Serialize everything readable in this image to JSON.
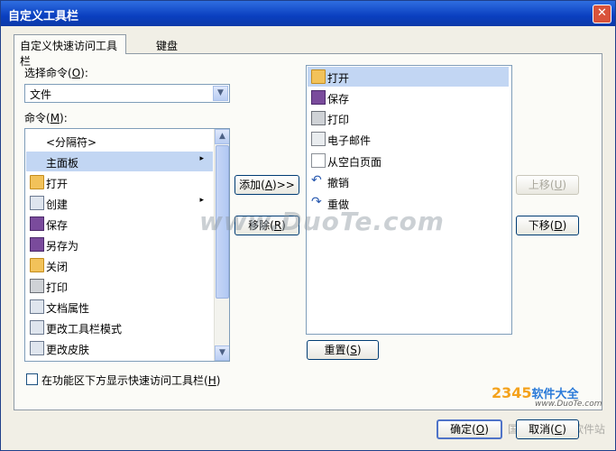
{
  "dialog": {
    "title": "自定义工具栏",
    "close": "✕"
  },
  "tabs": [
    {
      "label": "自定义快速访问工具栏"
    },
    {
      "label": "键盘"
    }
  ],
  "choose_command": {
    "label_pre": "选择命令(",
    "label_key": "O",
    "label_post": "):",
    "selected_value": "文件"
  },
  "commands": {
    "label_pre": "命令(",
    "label_key": "M",
    "label_post": "):",
    "items": [
      {
        "label": "<分隔符>",
        "icon": "none"
      },
      {
        "label": "主面板",
        "icon": "none",
        "submenu": "▸"
      },
      {
        "label": "打开",
        "icon": "folder-open-icon"
      },
      {
        "label": "创建",
        "icon": "new-document-icon",
        "submenu": "▸"
      },
      {
        "label": "保存",
        "icon": "save-icon"
      },
      {
        "label": "另存为",
        "icon": "save-as-icon"
      },
      {
        "label": "关闭",
        "icon": "close-folder-icon"
      },
      {
        "label": "打印",
        "icon": "printer-icon"
      },
      {
        "label": "文档属性",
        "icon": "properties-icon"
      },
      {
        "label": "更改工具栏模式",
        "icon": "toolbar-mode-icon"
      },
      {
        "label": "更改皮肤",
        "icon": "skin-icon"
      }
    ]
  },
  "toolbar_items": {
    "items": [
      {
        "label": "打开",
        "icon": "folder-open-icon"
      },
      {
        "label": "保存",
        "icon": "save-icon"
      },
      {
        "label": "打印",
        "icon": "printer-icon"
      },
      {
        "label": "电子邮件",
        "icon": "email-icon"
      },
      {
        "label": "从空白页面",
        "icon": "blank-page-icon"
      },
      {
        "label": "撤销",
        "icon": "undo-icon"
      },
      {
        "label": "重做",
        "icon": "redo-icon"
      }
    ]
  },
  "buttons": {
    "add": {
      "pre": "添加(",
      "key": "A",
      "post": ")>>"
    },
    "remove": {
      "pre": "移除(",
      "key": "R",
      "post": ")"
    },
    "move_up": {
      "pre": "上移(",
      "key": "U",
      "post": ")"
    },
    "move_down": {
      "pre": "下移(",
      "key": "D",
      "post": ")"
    },
    "reset": {
      "pre": "重置(",
      "key": "S",
      "post": ")"
    },
    "ok": {
      "pre": "确定(",
      "key": "O",
      "post": ")"
    },
    "cancel": {
      "pre": "取消(",
      "key": "C",
      "post": ")"
    }
  },
  "checkbox": {
    "pre": "在功能区下方显示快速访问工具栏(",
    "key": "H",
    "post": ")",
    "checked": false
  },
  "watermarks": {
    "center": "www.DuoTe.com",
    "logo_main": "2345",
    "logo_suffix": "软件大全",
    "logo_url": "www.DuoTe.com",
    "bottom": "国内最安全的软件站"
  },
  "colors": {
    "title_bar": "#0a3fc0",
    "selection": "#c2d6f3",
    "close_button": "#d9533b"
  }
}
